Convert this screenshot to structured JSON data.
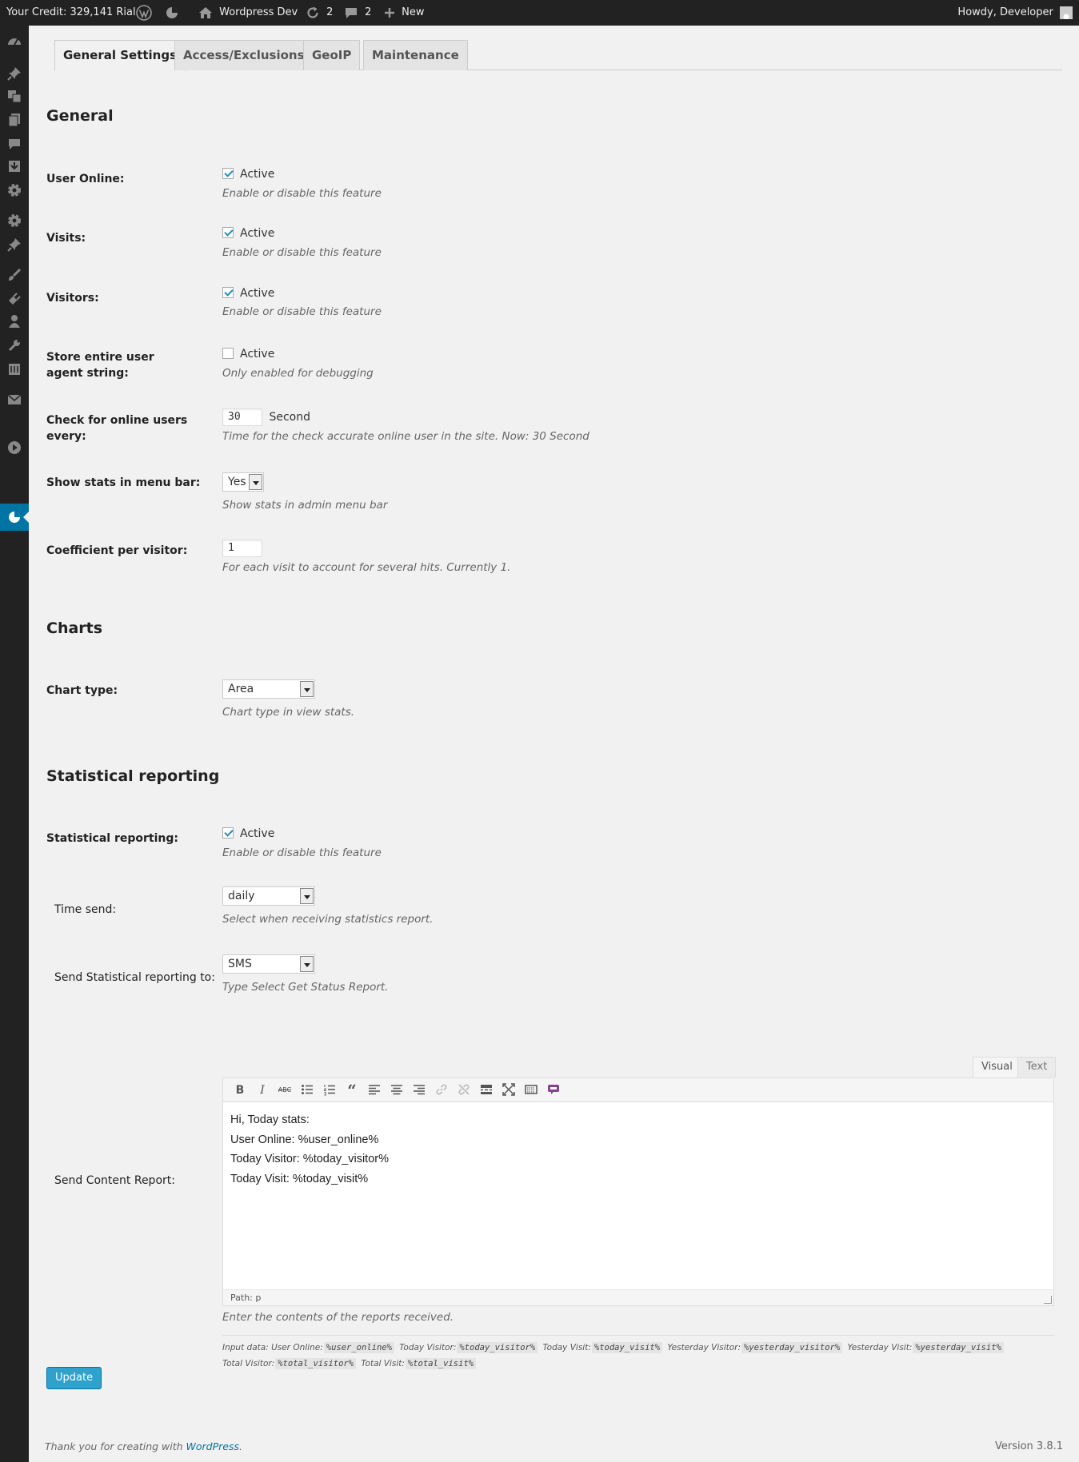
{
  "adminbar": {
    "credit": "Your Credit: 329,141 Rial",
    "site_name": "Wordpress Dev",
    "updates_count": "2",
    "comments_count": "2",
    "new_label": "New",
    "howdy": "Howdy, Developer"
  },
  "tabs": [
    {
      "label": "General Settings",
      "active": true
    },
    {
      "label": "Access/Exclusions"
    },
    {
      "label": "GeoIP"
    },
    {
      "label": "Maintenance"
    }
  ],
  "general": {
    "title": "General",
    "user_online": {
      "label": "User Online:",
      "checkbox_label": "Active",
      "checked": true,
      "desc": "Enable or disable this feature"
    },
    "visits": {
      "label": "Visits:",
      "checkbox_label": "Active",
      "checked": true,
      "desc": "Enable or disable this feature"
    },
    "visitors": {
      "label": "Visitors:",
      "checkbox_label": "Active",
      "checked": true,
      "desc": "Enable or disable this feature"
    },
    "user_agent": {
      "label": "Store entire user agent string:",
      "checkbox_label": "Active",
      "checked": false,
      "desc": "Only enabled for debugging"
    },
    "check_online": {
      "label": "Check for online users every:",
      "value": "30",
      "unit": "Second",
      "desc": "Time for the check accurate online user in the site. Now: 30 Second"
    },
    "menu_bar": {
      "label": "Show stats in menu bar:",
      "value": "Yes",
      "desc": "Show stats in admin menu bar"
    },
    "coefficient": {
      "label": "Coefficient per visitor:",
      "value": "1",
      "desc": "For each visit to account for several hits. Currently 1."
    }
  },
  "charts": {
    "title": "Charts",
    "chart_type": {
      "label": "Chart type:",
      "value": "Area",
      "desc": "Chart type in view stats."
    }
  },
  "reporting": {
    "title": "Statistical reporting",
    "enabled": {
      "label": "Statistical reporting:",
      "checkbox_label": "Active",
      "checked": true,
      "desc": "Enable or disable this feature"
    },
    "time_send": {
      "label": "Time send:",
      "value": "daily",
      "desc": "Select when receiving statistics report."
    },
    "send_to": {
      "label": "Send Statistical reporting to:",
      "value": "SMS",
      "desc": "Type Select Get Status Report."
    },
    "content": {
      "label": "Send Content Report:",
      "tab_visual": "Visual",
      "tab_text": "Text",
      "lines": [
        "Hi, Today stats:",
        "User Online: %user_online%",
        "Today Visitor: %today_visitor%",
        "Today Visit: %today_visit%"
      ],
      "path": "Path: p",
      "desc": "Enter the contents of the reports received."
    },
    "input_data": {
      "prefix": "Input data:",
      "items": [
        {
          "label": "User Online:",
          "code": "%user_online%"
        },
        {
          "label": "Today Visitor:",
          "code": "%today_visitor%"
        },
        {
          "label": "Today Visit:",
          "code": "%today_visit%"
        },
        {
          "label": "Yesterday Visitor:",
          "code": "%yesterday_visitor%"
        },
        {
          "label": "Yesterday Visit:",
          "code": "%yesterday_visit%"
        },
        {
          "label": "Total Visitor:",
          "code": "%total_visitor%"
        },
        {
          "label": "Total Visit:",
          "code": "%total_visit%"
        }
      ]
    }
  },
  "update_button": "Update",
  "footer": {
    "thanks": "Thank you for creating with ",
    "link": "WordPress",
    "after": ".",
    "version": "Version 3.8.1"
  }
}
